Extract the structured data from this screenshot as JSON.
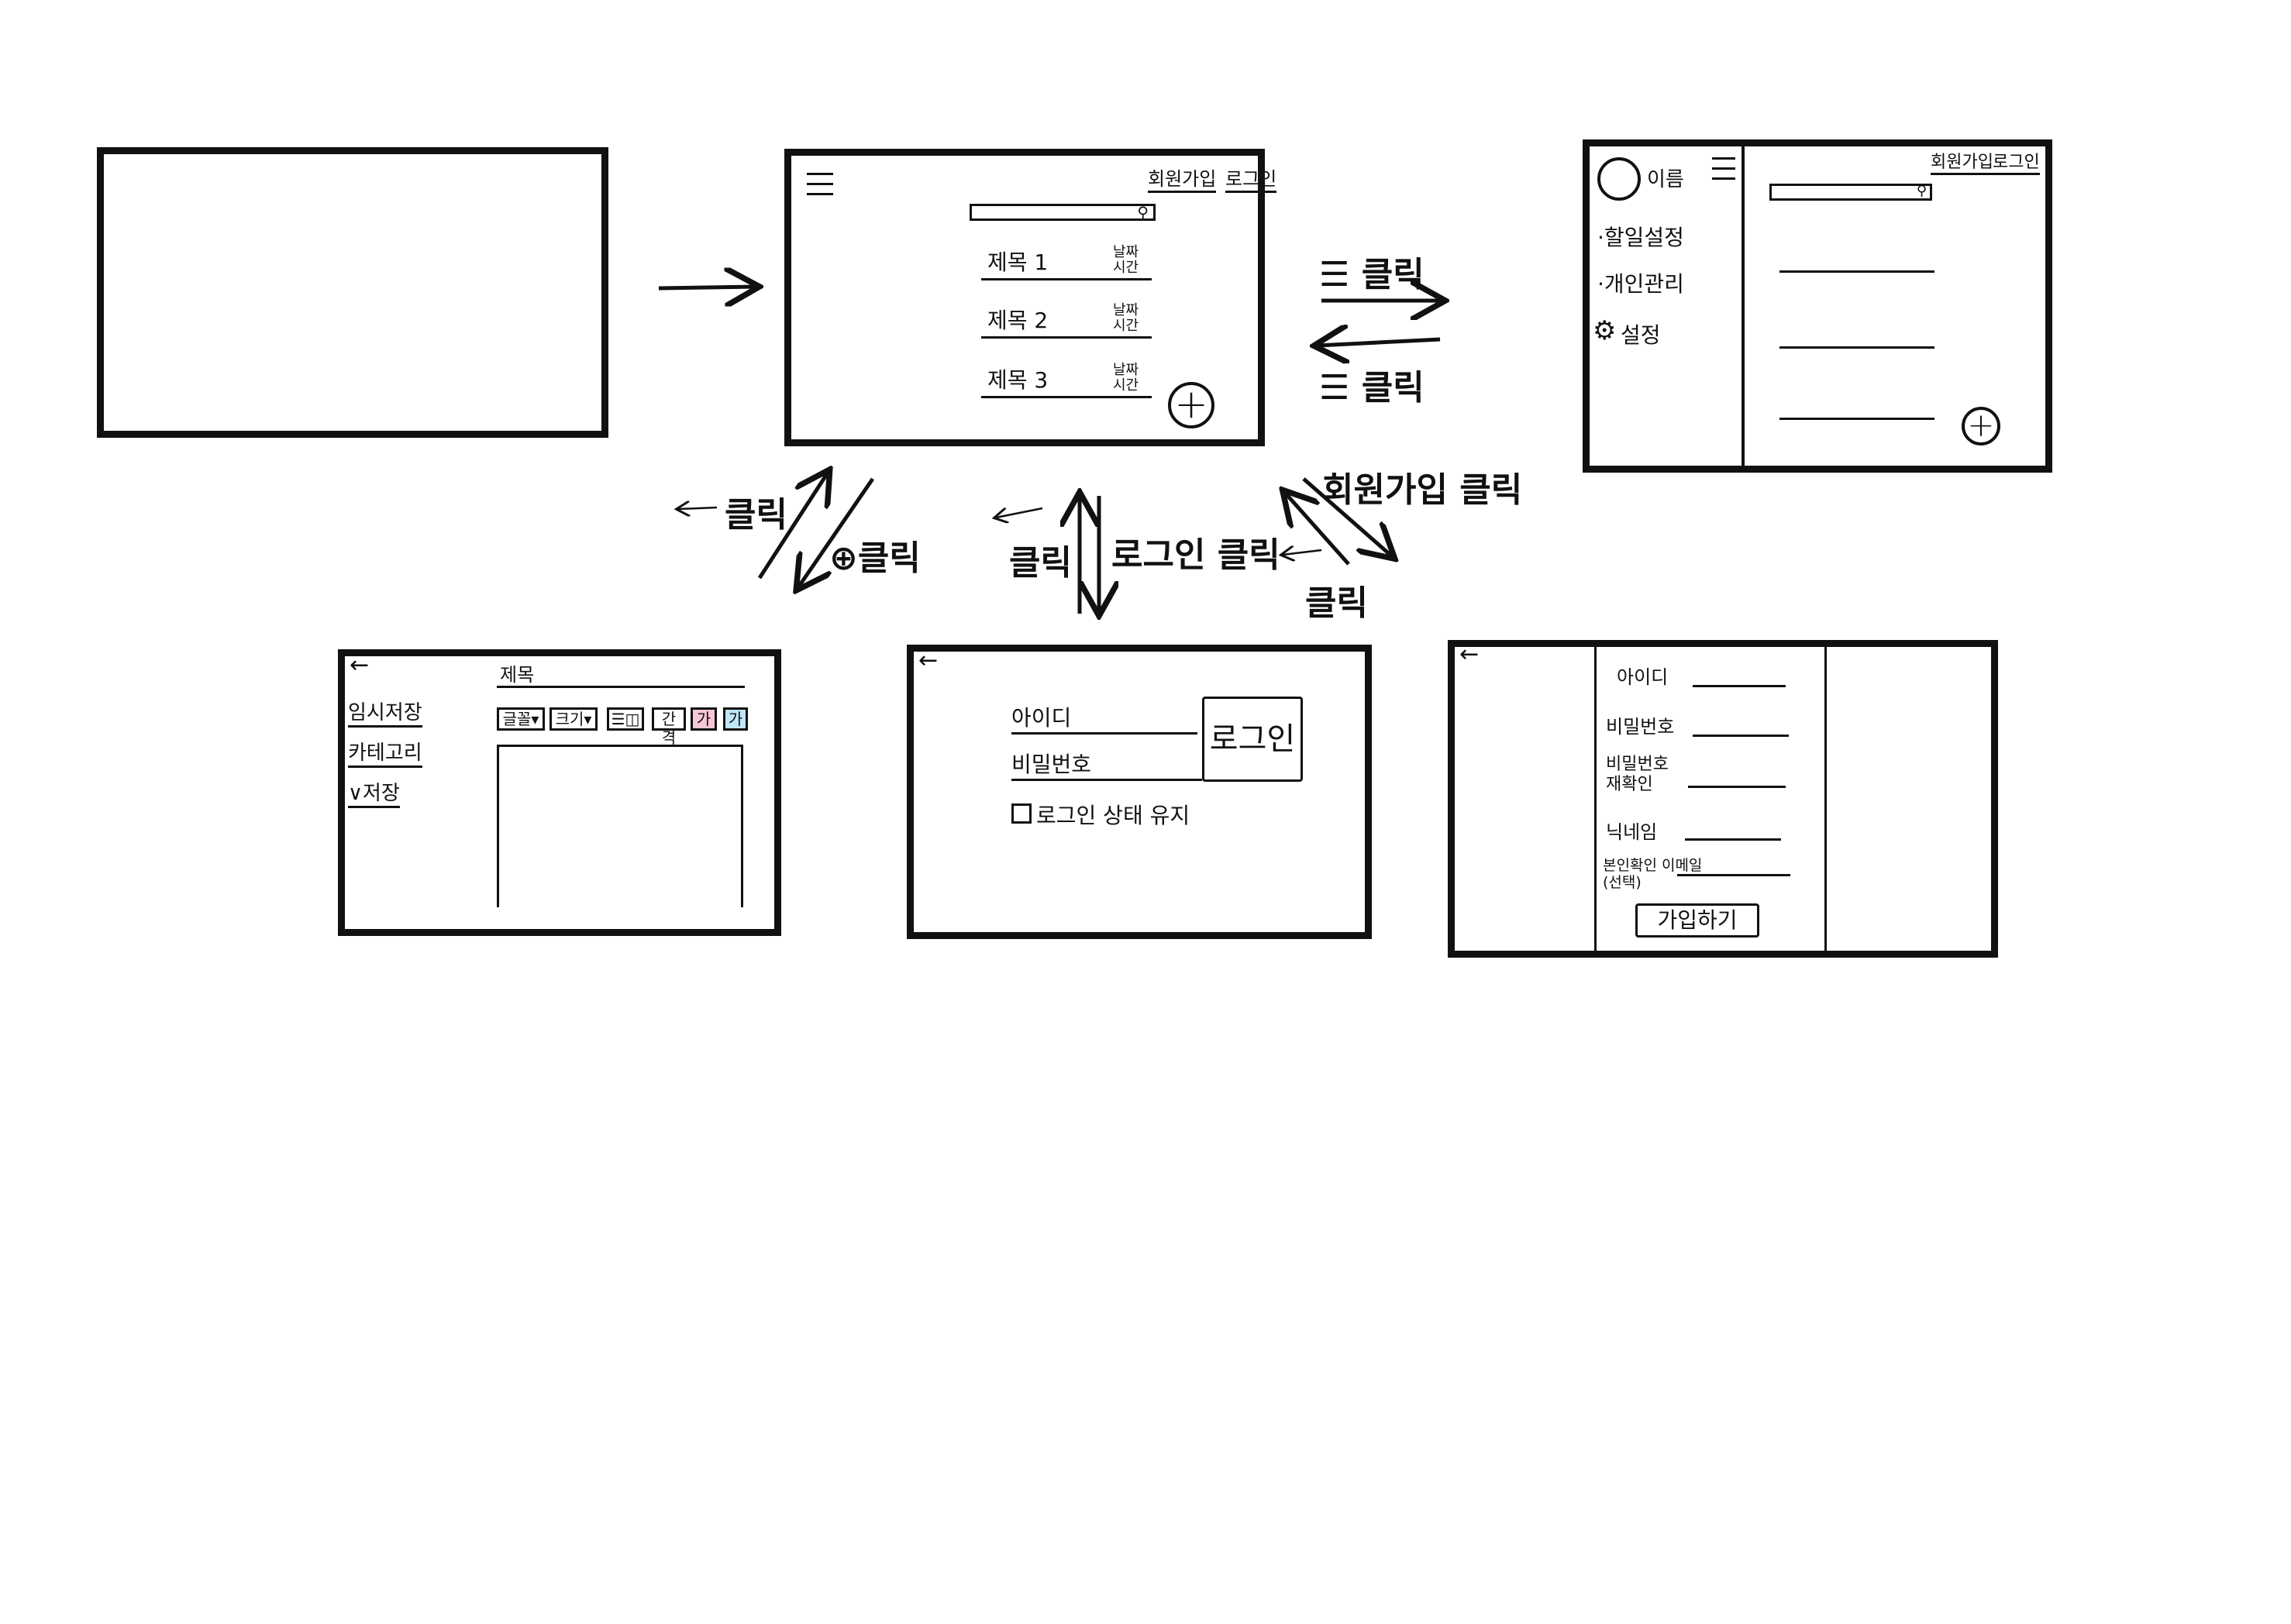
{
  "home": {
    "signup_link": "회원가입",
    "login_link": "로그인",
    "posts": [
      {
        "title": "제목 1",
        "meta_top": "날짜",
        "meta_bottom": "시간"
      },
      {
        "title": "제목 2",
        "meta_top": "날짜",
        "meta_bottom": "시간"
      },
      {
        "title": "제목 3",
        "meta_top": "날짜",
        "meta_bottom": "시간"
      }
    ],
    "add_symbol": "+"
  },
  "menu": {
    "profile_name": "이름",
    "items": [
      "·할일설정",
      "·개인관리",
      "설정"
    ],
    "signup_link": "회원가입",
    "login_link": "로그인",
    "add_symbol": "+"
  },
  "editor": {
    "back": "←",
    "sidebar": [
      "임시저장",
      "카테고리",
      "∨저장"
    ],
    "title_placeholder": "제목",
    "toolbar": [
      "글꼴▾",
      "크기▾",
      "☰◫",
      "간격",
      "가",
      "가"
    ],
    "toolbar_colors": [
      "#ffffff",
      "#ffffff",
      "#ffffff",
      "#ffffff",
      "#f7c6d9",
      "#bfe6f7"
    ]
  },
  "login": {
    "back": "←",
    "id_label": "아이디",
    "password_label": "비밀번호",
    "login_button": "로그인",
    "keep_logged_in": "로그인 상태 유지"
  },
  "signup": {
    "back": "←",
    "fields": [
      "아이디",
      "비밀번호",
      "비밀번호 재확인",
      "닉네임",
      "본인확인 이메일(선택)"
    ],
    "submit_button": "가입하기"
  },
  "transitions": {
    "hamburger_click_1": "☰ 클릭",
    "hamburger_click_2": "☰ 클릭",
    "back_click_editor": "클릭",
    "plus_click": "⊕클릭",
    "back_click_login": "클릭",
    "login_click": "로그인 클릭",
    "signup_click": "회원가입 클릭",
    "back_click_signup": "클릭",
    "back_arrow_hint": "←"
  }
}
